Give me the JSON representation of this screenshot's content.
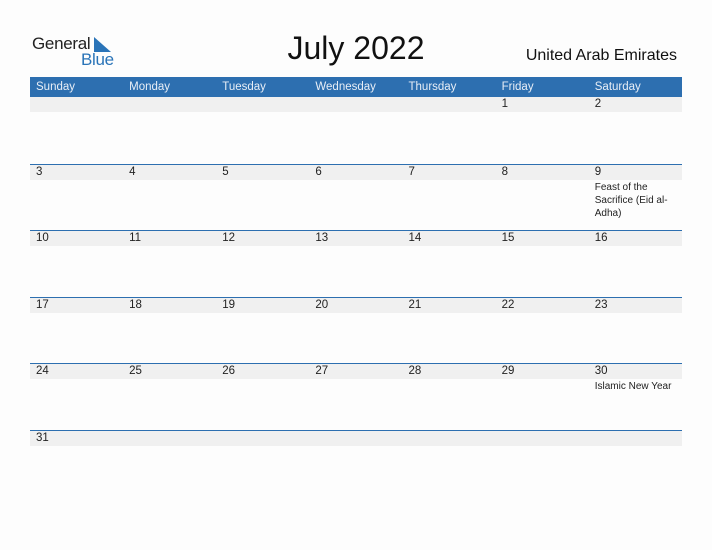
{
  "logo": {
    "part1": "General",
    "part2": "Blue",
    "accent": "#2a74b8"
  },
  "title": "July 2022",
  "country": "United Arab Emirates",
  "weekdays": [
    "Sunday",
    "Monday",
    "Tuesday",
    "Wednesday",
    "Thursday",
    "Friday",
    "Saturday"
  ],
  "weeks": [
    {
      "days": [
        {
          "num": "",
          "event": ""
        },
        {
          "num": "",
          "event": ""
        },
        {
          "num": "",
          "event": ""
        },
        {
          "num": "",
          "event": ""
        },
        {
          "num": "",
          "event": ""
        },
        {
          "num": "1",
          "event": ""
        },
        {
          "num": "2",
          "event": ""
        }
      ]
    },
    {
      "days": [
        {
          "num": "3",
          "event": ""
        },
        {
          "num": "4",
          "event": ""
        },
        {
          "num": "5",
          "event": ""
        },
        {
          "num": "6",
          "event": ""
        },
        {
          "num": "7",
          "event": ""
        },
        {
          "num": "8",
          "event": ""
        },
        {
          "num": "9",
          "event": "Feast of the Sacrifice (Eid al-Adha)"
        }
      ]
    },
    {
      "days": [
        {
          "num": "10",
          "event": ""
        },
        {
          "num": "11",
          "event": ""
        },
        {
          "num": "12",
          "event": ""
        },
        {
          "num": "13",
          "event": ""
        },
        {
          "num": "14",
          "event": ""
        },
        {
          "num": "15",
          "event": ""
        },
        {
          "num": "16",
          "event": ""
        }
      ]
    },
    {
      "days": [
        {
          "num": "17",
          "event": ""
        },
        {
          "num": "18",
          "event": ""
        },
        {
          "num": "19",
          "event": ""
        },
        {
          "num": "20",
          "event": ""
        },
        {
          "num": "21",
          "event": ""
        },
        {
          "num": "22",
          "event": ""
        },
        {
          "num": "23",
          "event": ""
        }
      ]
    },
    {
      "days": [
        {
          "num": "24",
          "event": ""
        },
        {
          "num": "25",
          "event": ""
        },
        {
          "num": "26",
          "event": ""
        },
        {
          "num": "27",
          "event": ""
        },
        {
          "num": "28",
          "event": ""
        },
        {
          "num": "29",
          "event": ""
        },
        {
          "num": "30",
          "event": "Islamic New Year"
        }
      ]
    },
    {
      "days": [
        {
          "num": "31",
          "event": ""
        },
        {
          "num": "",
          "event": ""
        },
        {
          "num": "",
          "event": ""
        },
        {
          "num": "",
          "event": ""
        },
        {
          "num": "",
          "event": ""
        },
        {
          "num": "",
          "event": ""
        },
        {
          "num": "",
          "event": ""
        }
      ]
    }
  ],
  "colors": {
    "header_bg": "#2d6fb0",
    "date_strip": "#f0f0f0"
  }
}
